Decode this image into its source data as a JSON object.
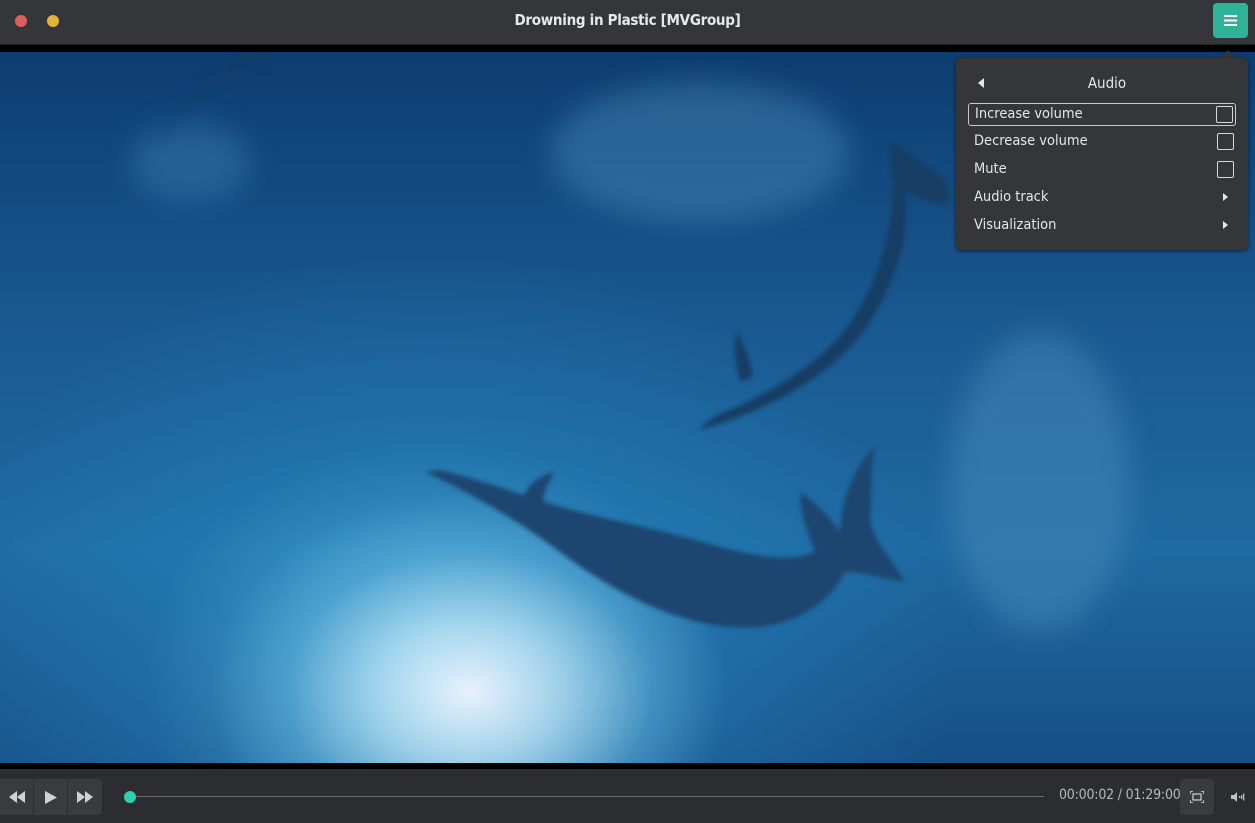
{
  "window": {
    "title": "Drowning in Plastic [MVGroup]",
    "buttons": [
      "close",
      "minimize"
    ],
    "menu_icon": "hamburger-icon",
    "accent_color": "#2eb398"
  },
  "video": {
    "content": "dolphins-underwater-frame"
  },
  "popover": {
    "title": "Audio",
    "back_icon": "back-arrow-icon",
    "items": [
      {
        "label": "Increase volume",
        "type": "checkbox",
        "checked": false,
        "focused": true
      },
      {
        "label": "Decrease volume",
        "type": "checkbox",
        "checked": false
      },
      {
        "label": "Mute",
        "type": "checkbox",
        "checked": false
      },
      {
        "label": "Audio track",
        "type": "submenu"
      },
      {
        "label": "Visualization",
        "type": "submenu"
      }
    ]
  },
  "controls": {
    "rewind_icon": "rewind-icon",
    "play_icon": "play-icon",
    "forward_icon": "fast-forward-icon",
    "time_display": "00:00:02 / 01:29:00",
    "progress": 0.0004,
    "fullscreen_icon": "fullscreen-icon",
    "volume_icon": "volume-icon",
    "seek_color": "#2ed0b0"
  }
}
